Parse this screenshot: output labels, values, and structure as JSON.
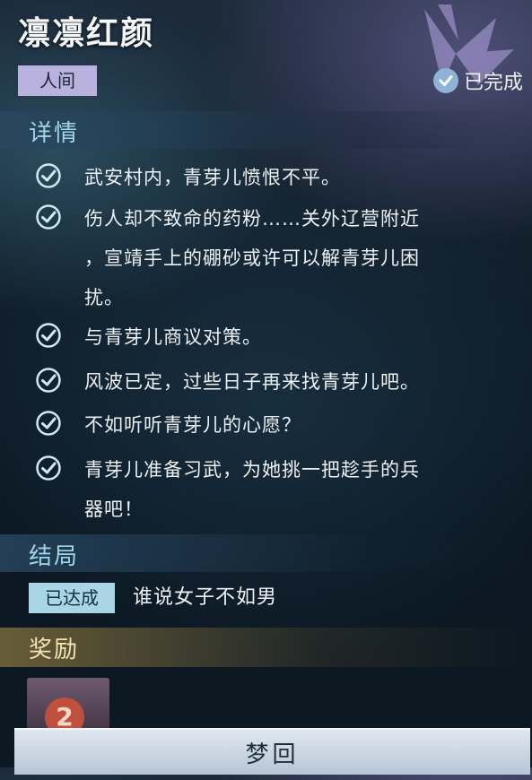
{
  "header": {
    "title": "凛凛红颜",
    "tag": "人间",
    "status": "已完成"
  },
  "details": {
    "heading": "详情",
    "items": [
      {
        "lines": [
          "武安村内，青芽儿愤恨不平。"
        ]
      },
      {
        "lines": [
          "伤人却不致命的药粉……关外辽营附近",
          "，宣靖手上的硼砂或许可以解青芽儿困",
          "扰。"
        ]
      },
      {
        "lines": [
          "与青芽儿商议对策。"
        ]
      },
      {
        "lines": [
          "风波已定，过些日子再来找青芽儿吧。"
        ]
      },
      {
        "lines": [
          "不如听听青芽儿的心愿？"
        ]
      },
      {
        "lines": [
          "青芽儿准备习武，为她挑一把趁手的兵",
          "器吧！"
        ]
      }
    ]
  },
  "ending": {
    "heading": "结局",
    "badge": "已达成",
    "text": "谁说女子不如男"
  },
  "rewards": {
    "heading": "奖励",
    "item_glyph": "2"
  },
  "footer": {
    "button_label": "梦回"
  },
  "colors": {
    "section_heading": "#9fd6ea",
    "tag_bg": "#b9b2de",
    "reached_bg": "#a9d5e4",
    "reward_heading": "#f4e3b0"
  }
}
